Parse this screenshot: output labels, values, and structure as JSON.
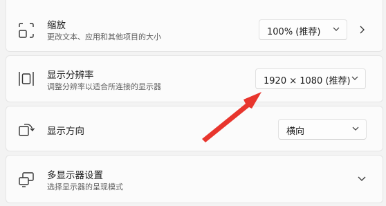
{
  "settings": [
    {
      "icon": "scale-icon",
      "title": "缩放",
      "subtitle": "更改文本、应用和其他项目的大小",
      "dropdown_value": "100% (推荐)",
      "trailing": "chevron-right-icon"
    },
    {
      "icon": "display-resolution-icon",
      "title": "显示分辨率",
      "subtitle": "调整分辨率以适合所连接的显示器",
      "dropdown_value": "1920 × 1080 (推荐)"
    },
    {
      "icon": "display-orientation-icon",
      "title": "显示方向",
      "dropdown_value": "横向"
    },
    {
      "icon": "multiple-displays-icon",
      "title": "多显示器设置",
      "subtitle": "选择显示器的呈现模式",
      "trailing": "chevron-down-icon"
    }
  ],
  "annotation": {
    "arrow_color": "#e8352d",
    "points_to": "resolution-dropdown"
  }
}
